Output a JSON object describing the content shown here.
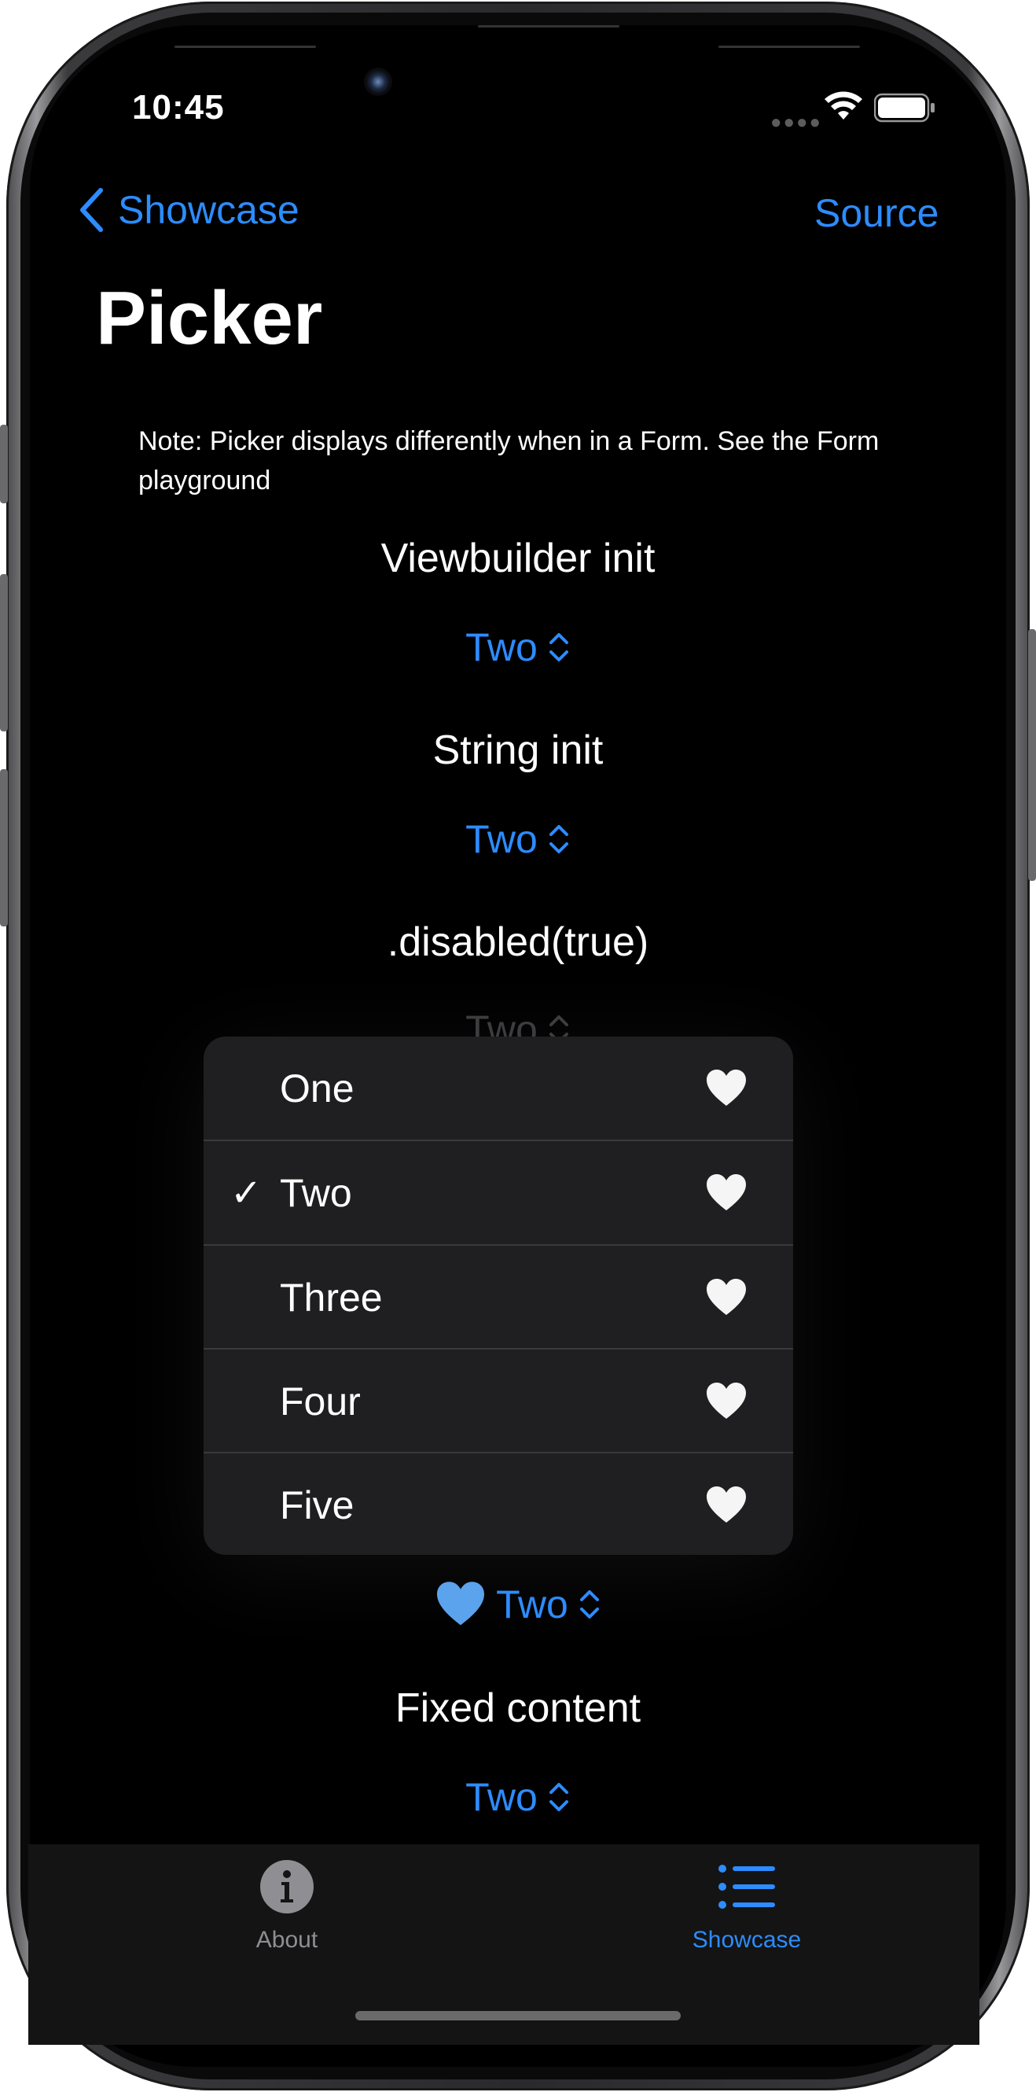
{
  "status_bar": {
    "time": "10:45"
  },
  "nav": {
    "back_label": "Showcase",
    "right_label": "Source",
    "title": "Picker"
  },
  "note": "Note: Picker displays differently when in a Form. See the Form playground",
  "sections": {
    "viewbuilder": {
      "label": "Viewbuilder init",
      "value": "Two"
    },
    "string": {
      "label": "String init",
      "value": "Two"
    },
    "disabled": {
      "label": ".disabled(true)",
      "value": "Two"
    },
    "label_picker": {
      "value": "Two"
    },
    "fixed": {
      "label": "Fixed content",
      "value": "Two"
    }
  },
  "menu": {
    "selected": "Two",
    "items": [
      {
        "label": "One",
        "icon": "heart-icon"
      },
      {
        "label": "Two",
        "icon": "heart-icon",
        "checked": true
      },
      {
        "label": "Three",
        "icon": "heart-icon"
      },
      {
        "label": "Four",
        "icon": "heart-icon"
      },
      {
        "label": "Five",
        "icon": "heart-icon"
      }
    ]
  },
  "tabs": [
    {
      "label": "About",
      "icon": "info-icon",
      "selected": false
    },
    {
      "label": "Showcase",
      "icon": "list-icon",
      "selected": true
    }
  ],
  "colors": {
    "accent": "#2d8cff",
    "background": "#000000",
    "menu_bg": "#1f1f21",
    "disabled": "#3e3e40",
    "tab_inactive": "#8e8e93"
  }
}
